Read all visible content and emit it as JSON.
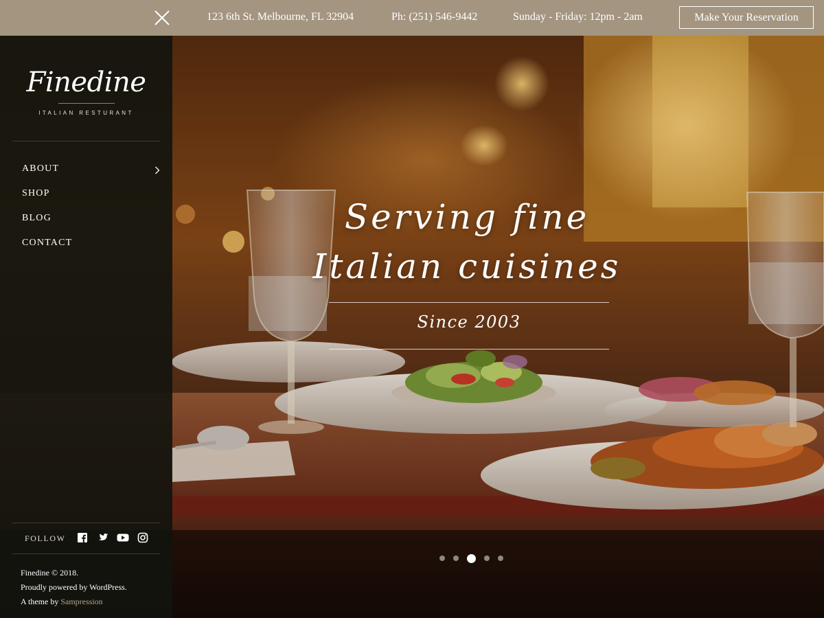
{
  "topbar": {
    "address": "123 6th St. Melbourne, FL 32904",
    "phone": "Ph: (251) 546-9442",
    "hours": "Sunday - Friday: 12pm - 2am",
    "reservation_label": "Make Your Reservation",
    "close_icon": "close-icon",
    "background_color": "#a39580"
  },
  "sidebar": {
    "logo_name": "Finedine",
    "logo_tagline": "ITALIAN RESTURANT",
    "nav": [
      {
        "label": "ABOUT",
        "has_submenu": true
      },
      {
        "label": "SHOP",
        "has_submenu": false
      },
      {
        "label": "BLOG",
        "has_submenu": false
      },
      {
        "label": "CONTACT",
        "has_submenu": false
      }
    ],
    "follow_label": "FOLLOW",
    "social": [
      "facebook-icon",
      "twitter-icon",
      "youtube-icon",
      "instagram-icon"
    ],
    "credits": {
      "line1": "Finedine © 2018.",
      "line2": "Proudly powered by WordPress.",
      "line3_prefix": "A theme by",
      "line3_link": "Sampression"
    }
  },
  "hero": {
    "title_line1": "Serving fine",
    "title_line2": "Italian cuisines",
    "subtitle": "Since 2003",
    "slides_total": 5,
    "active_slide": 3
  }
}
